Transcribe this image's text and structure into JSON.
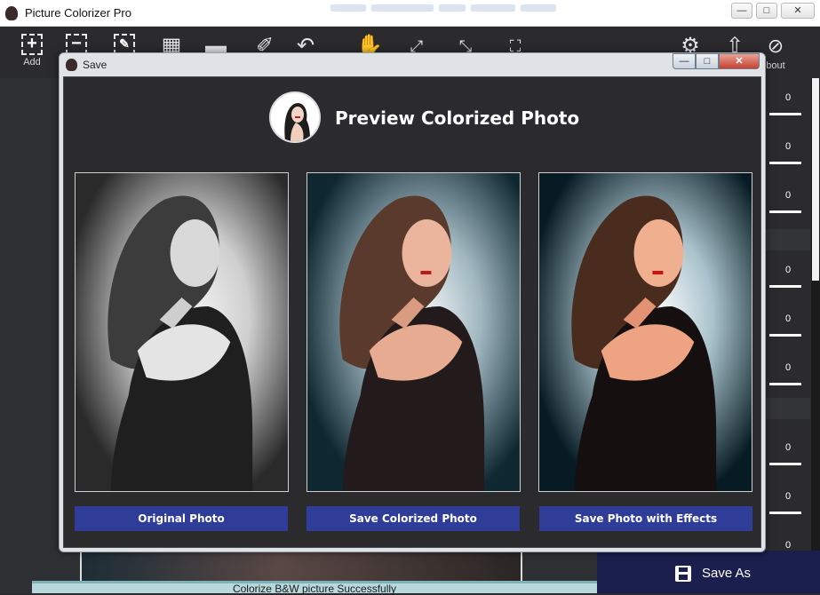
{
  "window": {
    "title": "Picture Colorizer Pro",
    "controls": {
      "minimize": "—",
      "maximize": "□",
      "close": "✕"
    }
  },
  "toolbar": {
    "add_label": "Add",
    "about_label": "bout",
    "tools": [
      {
        "name": "add",
        "icon": "add-icon"
      },
      {
        "name": "remove",
        "icon": "remove-icon"
      },
      {
        "name": "pick-color",
        "icon": "eyedropper-icon"
      },
      {
        "name": "mark",
        "icon": "grid-brush-icon"
      },
      {
        "name": "erase",
        "icon": "eraser-icon"
      },
      {
        "name": "brush",
        "icon": "brush-icon"
      },
      {
        "name": "undo",
        "icon": "undo-icon"
      },
      {
        "name": "move",
        "icon": "hand-icon"
      },
      {
        "name": "zoom-in",
        "icon": "expand-icon"
      },
      {
        "name": "zoom-out",
        "icon": "shrink-icon"
      },
      {
        "name": "fit",
        "icon": "fit-icon"
      },
      {
        "name": "settings",
        "icon": "gear-icon"
      },
      {
        "name": "upload",
        "icon": "upload-icon"
      },
      {
        "name": "about",
        "icon": "compass-icon"
      }
    ]
  },
  "dialog": {
    "title": "Save",
    "heading": "Preview Colorized Photo",
    "controls": {
      "minimize": "—",
      "maximize": "□",
      "close": "✕"
    },
    "buttons": {
      "original": "Original Photo",
      "colorized": "Save Colorized Photo",
      "effects": "Save Photo with Effects"
    }
  },
  "sliders": [
    "0",
    "0",
    "0",
    "0",
    "0",
    "0",
    "0",
    "0",
    "0"
  ],
  "save_as": {
    "label": "Save As"
  },
  "status": {
    "text": "Colorize B&W picture Successfully"
  },
  "colors": {
    "accent_button": "#2f3d98",
    "save_as_bg": "#1a1f4d",
    "dark_bg": "#2b2b2e",
    "status_bg": "#b9d8dc"
  }
}
